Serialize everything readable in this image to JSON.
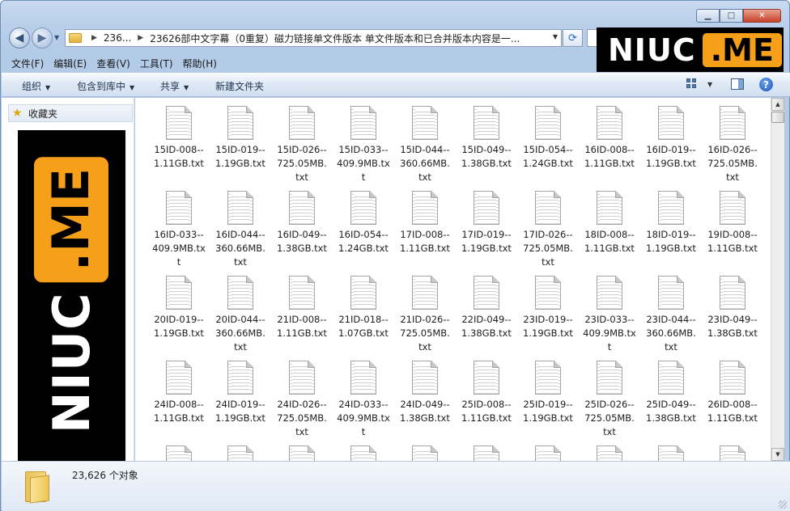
{
  "window": {
    "caption": {
      "min": "▁",
      "max": "□",
      "close": "✕"
    }
  },
  "nav": {
    "back_icon": "◀",
    "forward_icon": "▶",
    "dropdown_icon": "▼",
    "refresh_icon": "⟳"
  },
  "address": {
    "crumbs": [
      "236...",
      "23626部中文字幕（0重复）磁力链接单文件版本   单文件版本和已合并版本内容是一..."
    ]
  },
  "watermark": {
    "text": "NIUC",
    "box": ".ME"
  },
  "menu": [
    "文件(F)",
    "编辑(E)",
    "查看(V)",
    "工具(T)",
    "帮助(H)"
  ],
  "toolbar": {
    "organize": "组织",
    "include_library": "包含到库中",
    "share": "共享",
    "new_folder": "新建文件夹",
    "help_icon": "?"
  },
  "navpane": {
    "favorites": "收藏夹"
  },
  "files": [
    "15ID-008--1.11GB.txt",
    "15ID-019--1.19GB.txt",
    "15ID-026--725.05MB.txt",
    "15ID-033--409.9MB.txt",
    "15ID-044--360.66MB.txt",
    "15ID-049--1.38GB.txt",
    "15ID-054--1.24GB.txt",
    "16ID-008--1.11GB.txt",
    "16ID-019--1.19GB.txt",
    "16ID-026--725.05MB.txt",
    "16ID-033--409.9MB.txt",
    "16ID-044--360.66MB.txt",
    "16ID-049--1.38GB.txt",
    "16ID-054--1.24GB.txt",
    "17ID-008--1.11GB.txt",
    "17ID-019--1.19GB.txt",
    "17ID-026--725.05MB.txt",
    "18ID-008--1.11GB.txt",
    "18ID-019--1.19GB.txt",
    "19ID-008--1.11GB.txt",
    "20ID-019--1.19GB.txt",
    "20ID-044--360.66MB.txt",
    "21ID-008--1.11GB.txt",
    "21ID-018--1.07GB.txt",
    "21ID-026--725.05MB.txt",
    "22ID-049--1.38GB.txt",
    "23ID-019--1.19GB.txt",
    "23ID-033--409.9MB.txt",
    "23ID-044--360.66MB.txt",
    "23ID-049--1.38GB.txt",
    "24ID-008--1.11GB.txt",
    "24ID-019--1.19GB.txt",
    "24ID-026--725.05MB.txt",
    "24ID-033--409.9MB.txt",
    "24ID-049--1.38GB.txt",
    "25ID-008--1.11GB.txt",
    "25ID-019--1.19GB.txt",
    "25ID-026--725.05MB.txt",
    "25ID-049--1.38GB.txt",
    "26ID-008--1.11GB.txt",
    "",
    "",
    "",
    "",
    "",
    "",
    "",
    "",
    "",
    ""
  ],
  "details": {
    "count": "23,626 个对象"
  }
}
